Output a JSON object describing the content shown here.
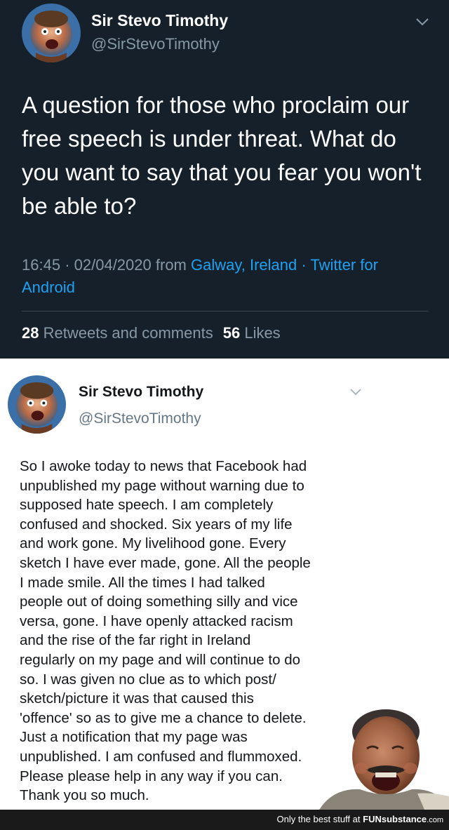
{
  "dark_tweet": {
    "author": {
      "name": "Sir Stevo Timothy",
      "handle": "@SirStevoTimothy"
    },
    "text": "A question for those who proclaim our free speech is under threat. What do you want to say that you fear you won't be able to?",
    "meta": {
      "time": "16:45",
      "separator": "·",
      "date": "02/04/2020",
      "from_label": "from",
      "location": "Galway, Ireland",
      "client": "Twitter for Android"
    },
    "stats": {
      "retweets_count": "28",
      "retweets_label": "Retweets and comments",
      "likes_count": "56",
      "likes_label": "Likes"
    },
    "chevron_icon": "chevron-down-icon"
  },
  "light_tweet": {
    "author": {
      "name": "Sir Stevo Timothy",
      "handle": "@SirStevoTimothy"
    },
    "text_lines": [
      "So I awoke today to news that Facebook had",
      "unpublished my page without warning due to",
      "supposed hate speech. I am completely",
      "confused and shocked. Six years of my life",
      "and work gone. My livelihood gone. Every",
      "sketch I have ever made, gone. All the people",
      "I made smile. All the times I had talked",
      "people out of doing something silly and vice",
      "versa, gone. I have openly attacked racism",
      "and the rise of the far right in Ireland",
      "regularly on my page and will continue to do",
      "so. I was given no clue as to which post/",
      "sketch/picture it was that caused this",
      "'offence' so as to give me a chance to delete.",
      "Just a notification that my page was",
      "unpublished. I am confused and flummoxed.",
      "Please please help in any way if you can.",
      "Thank you so much."
    ],
    "chevron_icon": "chevron-down-icon"
  },
  "footer": {
    "tagline": "Only the best stuff at",
    "brand_fun": "FUN",
    "brand_sub": "substance",
    "brand_tld": ".com"
  },
  "colors": {
    "dark_bg": "#15202b",
    "dark_secondary": "#8899a6",
    "link": "#1da1f2",
    "light_bg": "#ffffff",
    "light_secondary": "#657786"
  }
}
